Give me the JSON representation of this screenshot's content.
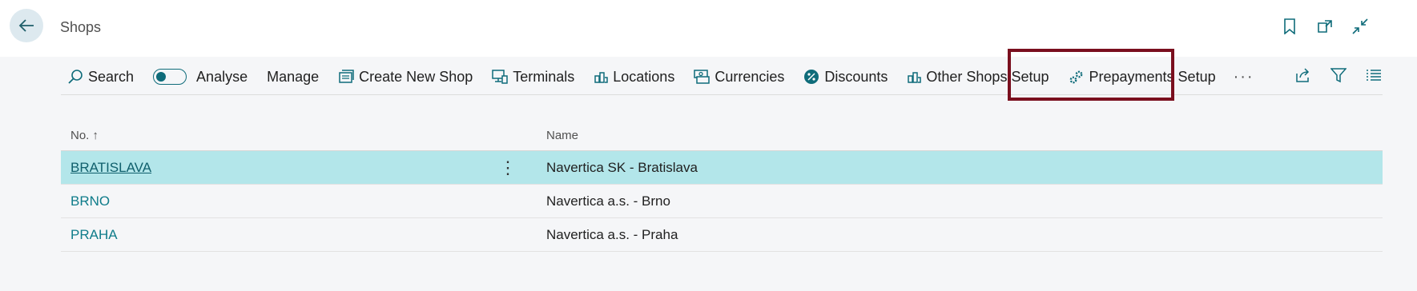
{
  "header": {
    "title": "Shops",
    "icons": [
      "back-arrow-icon",
      "bookmark-icon",
      "open-in-new-window-icon",
      "collapse-icon"
    ]
  },
  "toolbar": {
    "search_label": "Search",
    "analyse_label": "Analyse",
    "manage_label": "Manage",
    "create_new_shop_label": "Create New Shop",
    "terminals_label": "Terminals",
    "locations_label": "Locations",
    "currencies_label": "Currencies",
    "discounts_label": "Discounts",
    "other_shops_setup_label": "Other Shops Setup",
    "prepayments_setup_label": "Prepayments Setup",
    "more_label": "···"
  },
  "table": {
    "columns": [
      "No.",
      "Name"
    ],
    "sort_indicator": "↑",
    "rows": [
      {
        "no": "BRATISLAVA",
        "name": "Navertica SK - Bratislava",
        "selected": true
      },
      {
        "no": "BRNO",
        "name": "Navertica a.s. - Brno",
        "selected": false
      },
      {
        "no": "PRAHA",
        "name": "Navertica a.s. - Praha",
        "selected": false
      }
    ]
  },
  "colors": {
    "accent": "#0f6c7a",
    "selected_row": "#b3e6ea",
    "highlight_border": "#7a0f1e"
  }
}
